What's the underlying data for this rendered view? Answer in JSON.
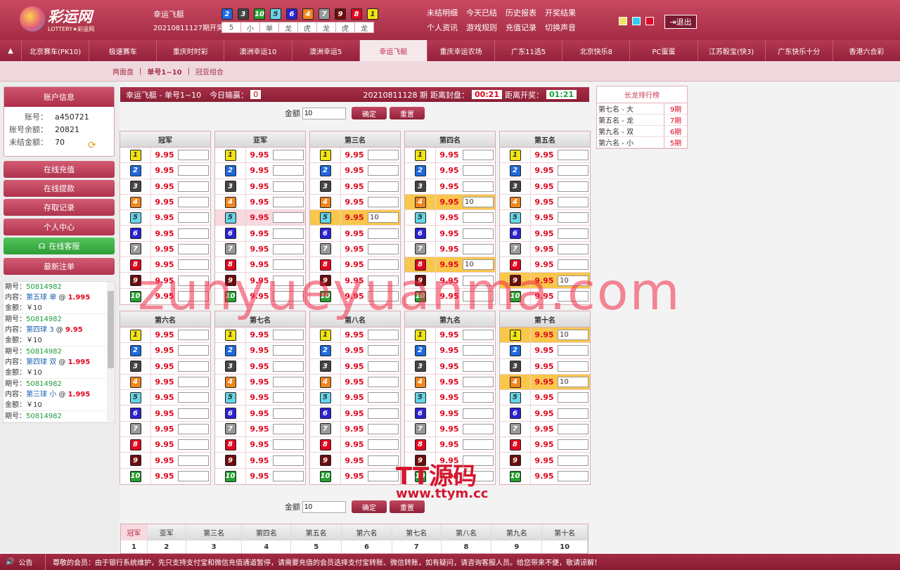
{
  "logo": {
    "name": "彩运网",
    "sub": "LOTTERY★彩运网"
  },
  "header": {
    "lottery": "幸运飞艇",
    "issue_label": "20210811127期开奖",
    "balls": [
      {
        "n": "2",
        "c": "#1e69de"
      },
      {
        "n": "3",
        "c": "#444444"
      },
      {
        "n": "10",
        "c": "#27a130"
      },
      {
        "n": "5",
        "c": "#65d5e8"
      },
      {
        "n": "6",
        "c": "#2b22d2"
      },
      {
        "n": "4",
        "c": "#f0851e"
      },
      {
        "n": "7",
        "c": "#999999"
      },
      {
        "n": "9",
        "c": "#6e0c0c"
      },
      {
        "n": "8",
        "c": "#e1061f"
      },
      {
        "n": "1",
        "c": "#f2e411"
      }
    ],
    "tags": [
      "5",
      "小",
      "单",
      "龙",
      "虎",
      "龙",
      "虎",
      "龙"
    ],
    "links": [
      "未结明细",
      "今天已结",
      "历史报表",
      "开奖结果",
      "个人资讯",
      "游戏规则",
      "充值记录",
      "切换声音"
    ],
    "theme_colors": [
      "#f5e268",
      "#2fd0ef",
      "#e1062b"
    ],
    "logout": "退出"
  },
  "nav": {
    "arrow": "▲",
    "items": [
      "北京赛车(PK10)",
      "极速赛车",
      "重庆时时彩",
      "澳洲幸运10",
      "澳洲幸运5",
      "幸运飞艇",
      "重庆幸运农场",
      "广东11选5",
      "北京快乐8",
      "PC蛋蛋",
      "江苏骰宝(快3)",
      "广东快乐十分",
      "香港六合彩"
    ],
    "active": "幸运飞艇"
  },
  "subnav": [
    "两面盘",
    "|",
    "单号1~10",
    "|",
    "冠亚组合"
  ],
  "sidebar": {
    "title": "账户信息",
    "account_k": "账号：",
    "account_v": "a450721",
    "balance_k": "账号余额：",
    "balance_v": "20821",
    "unsettled_k": "未结金额：",
    "unsettled_v": "70",
    "buttons": [
      "在线充值",
      "在线提款",
      "存取记录",
      "个人中心",
      "在线客服",
      "最新注单"
    ],
    "bets": [
      {
        "issue": "期号：",
        "no": "50814982",
        "content": "内容：",
        "pos": "第五球",
        "pick": "单",
        "at": "@",
        "odds": "1.995",
        "amt": "金额：￥10"
      },
      {
        "issue": "期号：",
        "no": "50814982",
        "content": "内容：",
        "pos": "第四球",
        "pick": "3",
        "at": "@",
        "odds": "9.95",
        "amt": "金额：￥10"
      },
      {
        "issue": "期号：",
        "no": "50814982",
        "content": "内容：",
        "pos": "第四球",
        "pick": "双",
        "at": "@",
        "odds": "1.995",
        "amt": "金额：￥10"
      },
      {
        "issue": "期号：",
        "no": "50814982",
        "content": "内容：",
        "pos": "第三球",
        "pick": "小",
        "at": "@",
        "odds": "1.995",
        "amt": "金额：￥10"
      },
      {
        "issue": "期号：",
        "no": "50814982",
        "content": "",
        "pos": "",
        "pick": "",
        "at": "",
        "odds": "",
        "amt": ""
      }
    ]
  },
  "main": {
    "title": "幸运飞艇  -  单号1~10",
    "profit_label": "今日输赢：",
    "profit": "0",
    "issue": "20210811128 期",
    "close_label": "距离封盘：",
    "close_time": "00:21",
    "draw_label": "距离开奖：",
    "draw_time": "01:21",
    "amount_label": "金额",
    "amount_value": "10",
    "confirm": "确定",
    "reset": "重置",
    "odds": "9.95",
    "bet_value": "10",
    "groups": [
      "冠军",
      "亚军",
      "第三名",
      "第四名",
      "第五名",
      "第六名",
      "第七名",
      "第八名",
      "第九名",
      "第十名"
    ],
    "bottom_headers": [
      "冠军",
      "亚军",
      "第三名",
      "第四名",
      "第五名",
      "第六名",
      "第七名",
      "第八名",
      "第九名",
      "第十名"
    ],
    "bottom_values": [
      "1",
      "2",
      "3",
      "4",
      "5",
      "6",
      "7",
      "8",
      "9",
      "10"
    ]
  },
  "rank": {
    "title": "长龙排行榜",
    "rows": [
      {
        "l": "第七名 - 大",
        "r": "9期"
      },
      {
        "l": "第五名 - 龙",
        "r": "7期"
      },
      {
        "l": "第九名 - 双",
        "r": "6期"
      },
      {
        "l": "第六名 - 小",
        "r": "5期"
      }
    ]
  },
  "marquee": {
    "label": "公告",
    "text": "尊敬的会员：由于银行系统维护，先只支持支付宝和微信充值通道暂停，请需要充值的会员选择支付宝转账、微信转账，如有疑问，请咨询客服人员。给您带来不便，敬请谅解！"
  },
  "watermark": "zunyueyuanma.com",
  "stamp": {
    "a": "TT源码",
    "b": "www.ttym.cc"
  }
}
